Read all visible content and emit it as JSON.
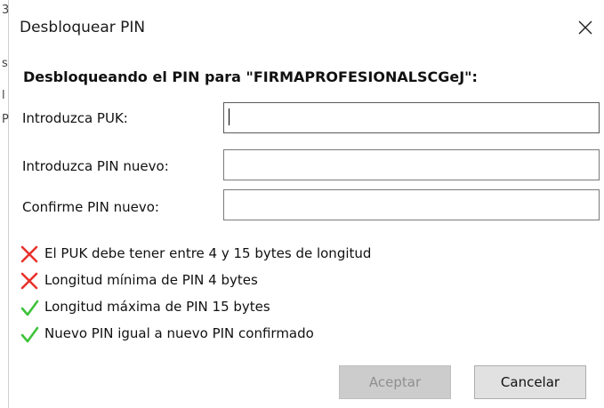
{
  "background_window": {
    "edge_glyphs": [
      "3",
      "s",
      "l",
      "P"
    ]
  },
  "dialog": {
    "title": "Desbloquear PIN",
    "heading": "Desbloqueando el PIN para \"FIRMAPROFESIONALSCGeJ\":",
    "close_icon": "close-x-icon"
  },
  "fields": {
    "puk": {
      "label": "Introduzca PUK:",
      "value": "",
      "focused": true
    },
    "new_pin": {
      "label": "Introduzca PIN nuevo:",
      "value": ""
    },
    "confirm_pin": {
      "label": "Confirme PIN nuevo:",
      "value": ""
    }
  },
  "rules": [
    {
      "text": "El PUK debe tener entre 4 y 15 bytes de longitud",
      "status": "fail",
      "icon": "red-cross-icon"
    },
    {
      "text": "Longitud mínima de PIN 4 bytes",
      "status": "fail",
      "icon": "red-cross-icon"
    },
    {
      "text": "Longitud máxima de PIN 15 bytes",
      "status": "pass",
      "icon": "green-check-icon"
    },
    {
      "text": "Nuevo PIN igual a nuevo PIN confirmado",
      "status": "pass",
      "icon": "green-check-icon"
    }
  ],
  "buttons": {
    "accept": {
      "label": "Aceptar",
      "enabled": false
    },
    "cancel": {
      "label": "Cancelar",
      "enabled": true
    }
  },
  "colors": {
    "fail": "#e8312a",
    "pass": "#3ec23a",
    "disabled_button_bg": "#cccccc",
    "button_bg": "#e1e1e1"
  }
}
